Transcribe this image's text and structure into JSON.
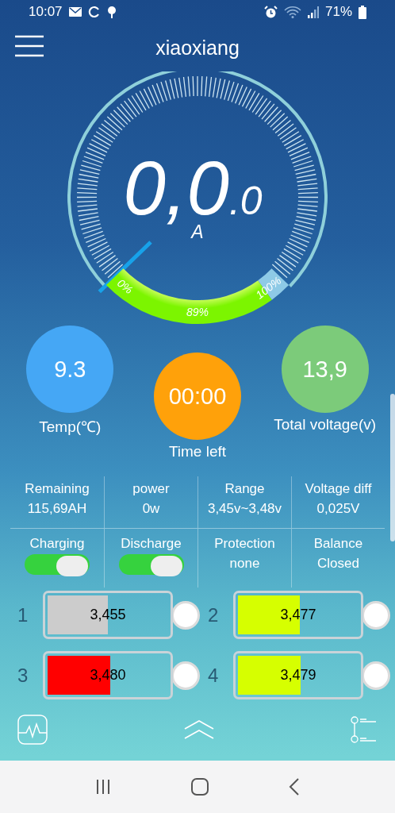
{
  "status_bar": {
    "time": "10:07",
    "battery": "71%"
  },
  "app_bar": {
    "title": "xiaoxiang"
  },
  "gauge": {
    "reading": "0,0",
    "decimal": ".0",
    "unit": "A",
    "start_label": "0%",
    "level_label": "89%",
    "end_label": "100%"
  },
  "circles": [
    {
      "value": "9.3",
      "label": "Temp(℃)",
      "color": "#45a7f5"
    },
    {
      "value": "00:00",
      "label": "Time left",
      "color": "#ffa10a"
    },
    {
      "value": "13,9",
      "label": "Total voltage(v)",
      "color": "#7ccb7a"
    }
  ],
  "stats": [
    {
      "label": "Remaining",
      "value": "115,69AH"
    },
    {
      "label": "power",
      "value": "0w"
    },
    {
      "label": "Range",
      "value": "3,45v~3,48v"
    },
    {
      "label": "Voltage diff",
      "value": "0,025V"
    }
  ],
  "controls": [
    {
      "kind": "switch",
      "label": "Charging",
      "on": true
    },
    {
      "kind": "switch",
      "label": "Discharge",
      "on": true
    },
    {
      "kind": "text",
      "label": "Protection",
      "value": "none"
    },
    {
      "kind": "text",
      "label": "Balance",
      "value": "Closed"
    }
  ],
  "cells": [
    {
      "number": "1",
      "voltage": "3,455",
      "level": 0.5,
      "color": "#cccccc"
    },
    {
      "number": "2",
      "voltage": "3,477",
      "level": 0.51,
      "color": "#d6ff00"
    },
    {
      "number": "3",
      "voltage": "3,480",
      "level": 0.52,
      "color": "#ff0000"
    },
    {
      "number": "4",
      "voltage": "3,479",
      "level": 0.52,
      "color": "#d6ff00"
    }
  ]
}
